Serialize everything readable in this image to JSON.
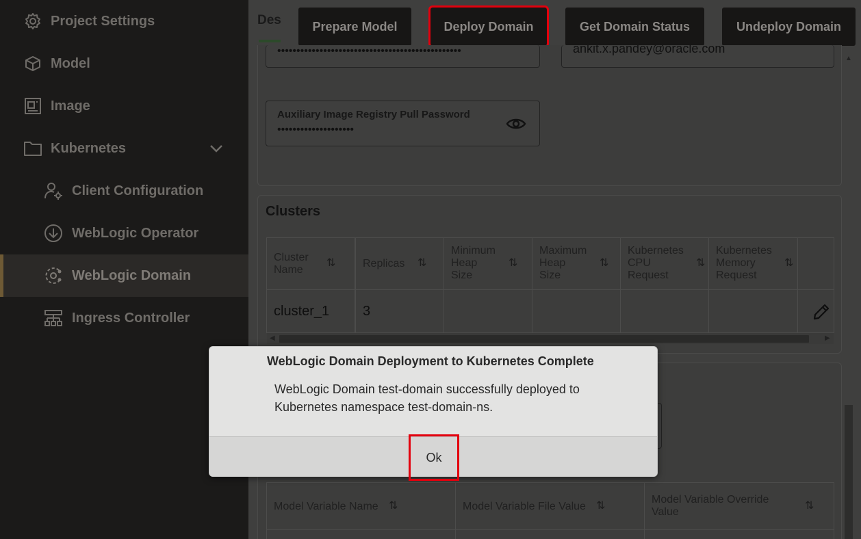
{
  "sidebar": {
    "items": [
      {
        "label": "Project Settings",
        "icon": "gear-icon"
      },
      {
        "label": "Model",
        "icon": "cube-icon"
      },
      {
        "label": "Image",
        "icon": "image-icon"
      },
      {
        "label": "Kubernetes",
        "icon": "folder-icon"
      },
      {
        "label": "Client Configuration",
        "icon": "user-gear-icon"
      },
      {
        "label": "WebLogic Operator",
        "icon": "download-circle-icon"
      },
      {
        "label": "WebLogic Domain",
        "icon": "domain-icon"
      },
      {
        "label": "Ingress Controller",
        "icon": "network-icon"
      }
    ],
    "active": "WebLogic Domain"
  },
  "toolbar": {
    "tab_label": "Des",
    "prepare_label": "Prepare Model",
    "deploy_label": "Deploy Domain",
    "status_label": "Get Domain Status",
    "undeploy_label": "Undeploy Domain"
  },
  "form": {
    "password_top_value": "••••••••••••••••••••••••••••••••••••••••••••••••",
    "email_value": "ankit.x.pandey@oracle.com",
    "aux_pw_label": "Auxiliary Image Registry Pull Password",
    "aux_pw_value": "••••••••••••••••••••"
  },
  "clusters": {
    "title": "Clusters",
    "columns": [
      [
        "Cluster",
        "Name"
      ],
      [
        "Replicas"
      ],
      [
        "Minimum",
        "Heap",
        "Size"
      ],
      [
        "Maximum",
        "Heap",
        "Size"
      ],
      [
        "Kubernetes",
        "CPU",
        "Request"
      ],
      [
        "Kubernetes",
        "Memory",
        "Request"
      ]
    ],
    "rows": [
      {
        "name": "cluster_1",
        "replicas": "3"
      }
    ]
  },
  "variables": {
    "columns": [
      "Model Variable Name",
      "Model Variable File Value",
      "Model Variable Override Value"
    ]
  },
  "dialog": {
    "title": "WebLogic Domain Deployment to Kubernetes Complete",
    "message": "WebLogic Domain test-domain successfully deployed to Kubernetes namespace test-domain-ns.",
    "ok_label": "Ok"
  },
  "colors": {
    "highlight": "#e3000d",
    "sidebar_bg": "#1b1a19",
    "overlay_bg": "#3f3f3e",
    "dialog_bg": "#e3e3e2"
  }
}
